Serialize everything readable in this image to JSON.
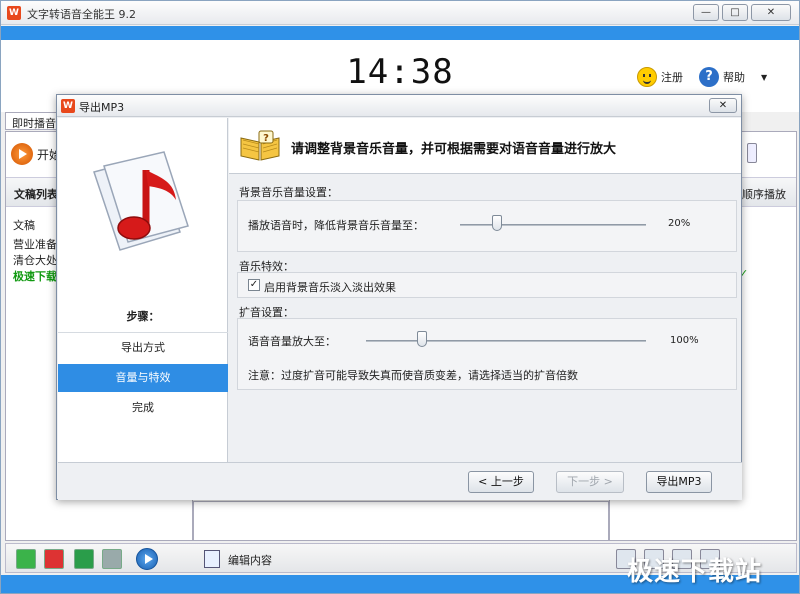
{
  "app": {
    "title": "文字转语音全能王 9.2",
    "clock": "14:38",
    "register_label": "注册",
    "help_label": "帮助",
    "tab_label": "即时播音",
    "start_label": "开始",
    "list_header": "文稿列表",
    "doc_col": "文稿",
    "docs": [
      "营业准备",
      "清仓大处",
      "极速下载"
    ],
    "right_header": "顺序播放",
    "edit_label": "编辑内容",
    "watermark": "极速下载站"
  },
  "dialog": {
    "title": "导出MP3",
    "banner": "请调整背景音乐音量，并可根据需要对语音音量进行放大",
    "steps_label": "步骤：",
    "steps": [
      "导出方式",
      "音量与特效",
      "完成"
    ],
    "active_step": 1,
    "bgm_group": "背景音乐音量设置：",
    "bgm_row": "播放语音时，降低背景音乐音量至：",
    "bgm_value": "20%",
    "bgm_fraction": 0.2,
    "effect_group": "音乐特效：",
    "fade_label": "启用背景音乐淡入淡出效果",
    "fade_checked": true,
    "amp_group": "扩音设置：",
    "amp_row": "语音音量放大至：",
    "amp_value": "100%",
    "amp_fraction": 0.2,
    "note": "注意：过度扩音可能导致失真而使音质变差，请选择适当的扩音倍数",
    "prev_label": "< 上一步",
    "next_label": "下一步 >",
    "export_label": "导出MP3"
  },
  "colors": {
    "accent": "#2f8de4",
    "band": "#2f91e8"
  }
}
